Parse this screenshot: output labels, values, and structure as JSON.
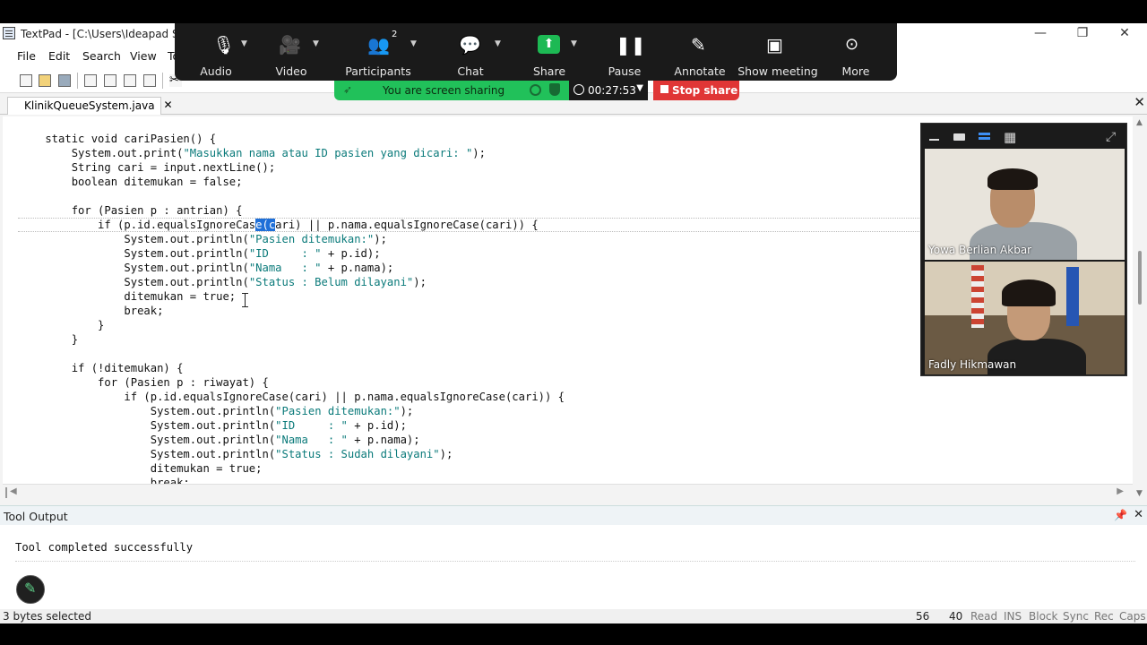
{
  "window": {
    "title": "TextPad - [C:\\Users\\Ideapad Slim",
    "minimize": "—",
    "restore": "❐",
    "close": "✕"
  },
  "menu": [
    "File",
    "Edit",
    "Search",
    "View",
    "To"
  ],
  "tab": {
    "label": "KlinikQueueSystem.java",
    "close": "✕"
  },
  "editor": {
    "lines": [
      [
        {
          "t": "    static void cariPasien() {"
        }
      ],
      [
        {
          "t": "        System.out.print("
        },
        {
          "t": "\"Masukkan nama atau ID pasien yang dicari: \"",
          "c": "s"
        },
        {
          "t": ");"
        }
      ],
      [
        {
          "t": "        String cari = input.nextLine();"
        }
      ],
      [
        {
          "t": "        boolean ditemukan = false;"
        }
      ],
      [
        {
          "t": ""
        }
      ],
      [
        {
          "t": "        for (Pasien p : antrian) {"
        }
      ],
      [
        {
          "t": "            if (p.id.equalsIgnoreCas"
        },
        {
          "t": "e(c",
          "c": "hl"
        },
        {
          "t": "ari) || p.nama.equalsIgnoreCase(cari)) {"
        }
      ],
      [
        {
          "t": "                System.out.println("
        },
        {
          "t": "\"Pasien ditemukan:\"",
          "c": "s"
        },
        {
          "t": ");"
        }
      ],
      [
        {
          "t": "                System.out.println("
        },
        {
          "t": "\"ID     : \"",
          "c": "s"
        },
        {
          "t": " + p.id);"
        }
      ],
      [
        {
          "t": "                System.out.println("
        },
        {
          "t": "\"Nama   : \"",
          "c": "s"
        },
        {
          "t": " + p.nama);"
        }
      ],
      [
        {
          "t": "                System.out.println("
        },
        {
          "t": "\"Status : Belum dilayani\"",
          "c": "s"
        },
        {
          "t": ");"
        }
      ],
      [
        {
          "t": "                ditemukan = true;"
        }
      ],
      [
        {
          "t": "                break;"
        }
      ],
      [
        {
          "t": "            }"
        }
      ],
      [
        {
          "t": "        }"
        }
      ],
      [
        {
          "t": ""
        }
      ],
      [
        {
          "t": "        if (!ditemukan) {"
        }
      ],
      [
        {
          "t": "            for (Pasien p : riwayat) {"
        }
      ],
      [
        {
          "t": "                if (p.id.equalsIgnoreCase(cari) || p.nama.equalsIgnoreCase(cari)) {"
        }
      ],
      [
        {
          "t": "                    System.out.println("
        },
        {
          "t": "\"Pasien ditemukan:\"",
          "c": "s"
        },
        {
          "t": ");"
        }
      ],
      [
        {
          "t": "                    System.out.println("
        },
        {
          "t": "\"ID     : \"",
          "c": "s"
        },
        {
          "t": " + p.id);"
        }
      ],
      [
        {
          "t": "                    System.out.println("
        },
        {
          "t": "\"Nama   : \"",
          "c": "s"
        },
        {
          "t": " + p.nama);"
        }
      ],
      [
        {
          "t": "                    System.out.println("
        },
        {
          "t": "\"Status : Sudah dilayani\"",
          "c": "s"
        },
        {
          "t": ");"
        }
      ],
      [
        {
          "t": "                    ditemukan = true;"
        }
      ],
      [
        {
          "t": "                    break;"
        }
      ]
    ]
  },
  "tool_output": {
    "title": "Tool Output",
    "message": "Tool completed successfully",
    "close": "✕"
  },
  "status": {
    "message": "3 bytes selected",
    "line": "56",
    "col": "40",
    "items": [
      "Read",
      "INS",
      "Block",
      "Sync",
      "Rec",
      "Caps"
    ]
  },
  "zoom": {
    "buttons": [
      {
        "name": "audio",
        "label": "Audio",
        "icon": "microphone-icon"
      },
      {
        "name": "video",
        "label": "Video",
        "icon": "camera-icon"
      },
      {
        "name": "participants",
        "label": "Participants",
        "icon": "people-icon",
        "count": "2"
      },
      {
        "name": "chat",
        "label": "Chat",
        "icon": "chat-icon"
      },
      {
        "name": "share",
        "label": "Share",
        "icon": "share-arrow-icon"
      },
      {
        "name": "pause",
        "label": "Pause",
        "icon": "pause-icon"
      },
      {
        "name": "annotate",
        "label": "Annotate",
        "icon": "pen-icon"
      },
      {
        "name": "show-meeting",
        "label": "Show meeting",
        "icon": "monitor-icon"
      },
      {
        "name": "more",
        "label": "More",
        "icon": "ellipsis-icon"
      }
    ],
    "sharing_text": "You are screen sharing",
    "timer": "00:27:53",
    "stop_share": "Stop share",
    "accent": "#21c15a",
    "stop_color": "#e03636"
  },
  "participants": [
    {
      "name": "Yowa Berlian  Akbar"
    },
    {
      "name": "Fadly Hikmawan"
    }
  ]
}
